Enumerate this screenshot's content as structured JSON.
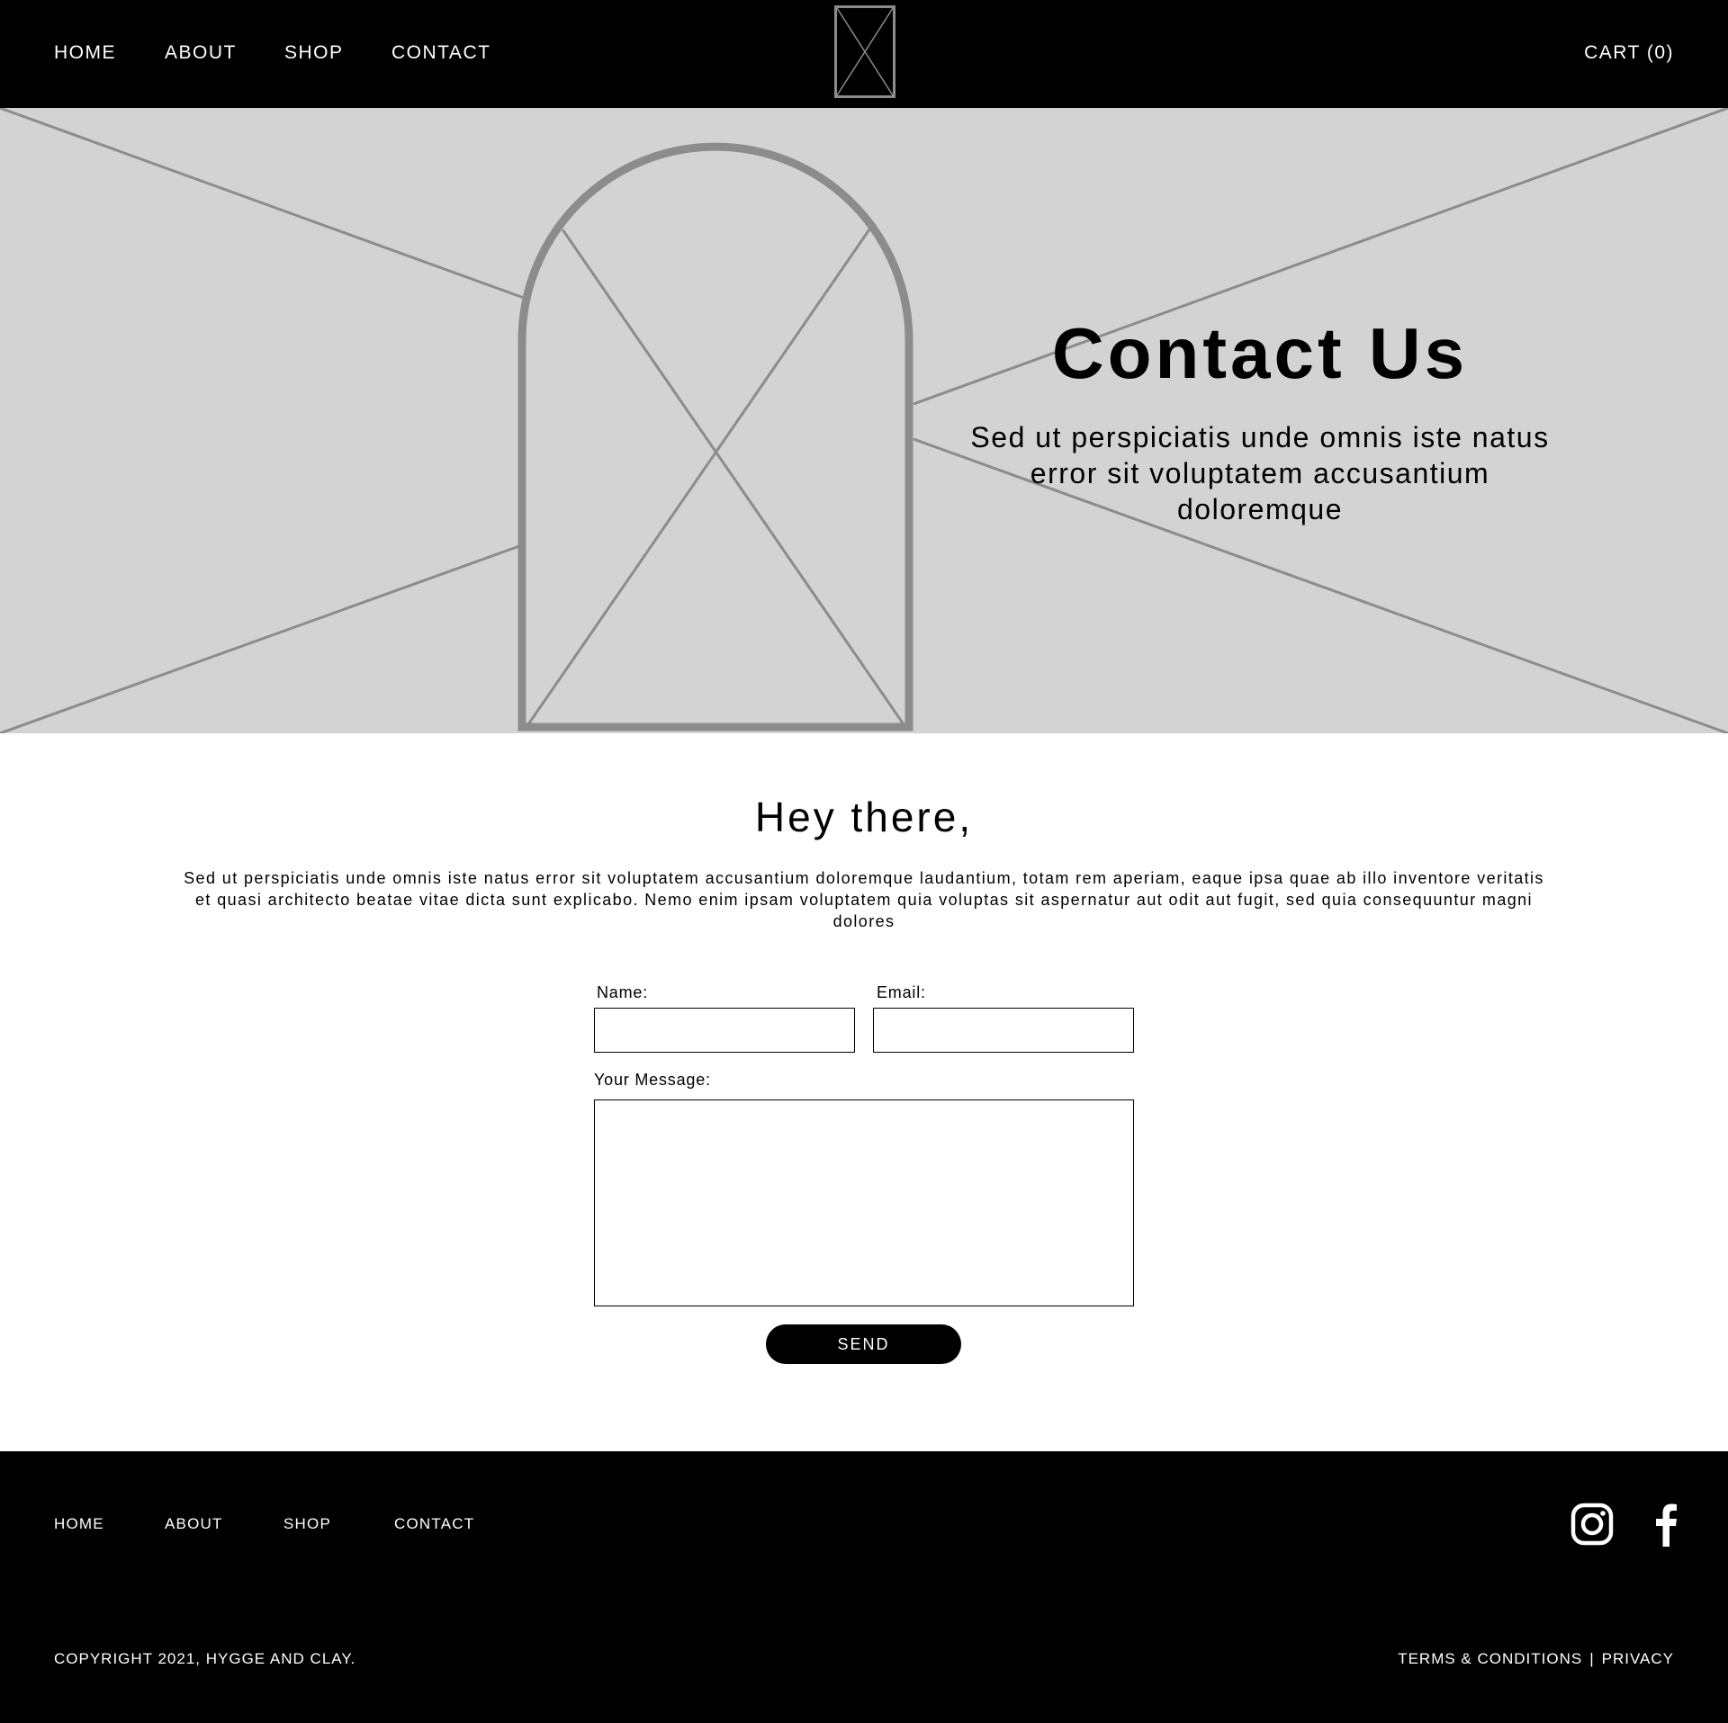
{
  "header": {
    "nav": [
      "HOME",
      "ABOUT",
      "SHOP",
      "CONTACT"
    ],
    "cart_label": "CART (0)"
  },
  "hero": {
    "title": "Contact Us",
    "subtitle": "Sed ut perspiciatis unde omnis iste natus error sit voluptatem accusantium doloremque"
  },
  "intro": {
    "heading": "Hey there,",
    "body": "Sed ut perspiciatis unde omnis iste natus error sit voluptatem accusantium doloremque laudantium, totam rem aperiam, eaque ipsa quae ab illo inventore veritatis et quasi architecto beatae vitae dicta sunt explicabo. Nemo enim ipsam voluptatem quia voluptas sit aspernatur aut odit aut fugit, sed quia consequuntur magni dolores"
  },
  "form": {
    "name_label": "Name:",
    "name_value": "",
    "email_label": "Email:",
    "email_value": "",
    "message_label": "Your Message:",
    "message_value": "",
    "send_label": "SEND"
  },
  "footer": {
    "nav": [
      "HOME",
      "ABOUT",
      "SHOP",
      "CONTACT"
    ],
    "social": [
      "instagram-icon",
      "facebook-icon"
    ],
    "copyright": "COPYRIGHT 2021, HYGGE AND CLAY.",
    "terms_label": "TERMS & CONDITIONS",
    "separator": "|",
    "privacy_label": "PRIVACY"
  },
  "colors": {
    "header_bg": "#000000",
    "hero_bg": "#d3d3d3",
    "placeholder_stroke": "#8c8c8c",
    "text": "#000000",
    "footer_text": "#ffffff"
  }
}
